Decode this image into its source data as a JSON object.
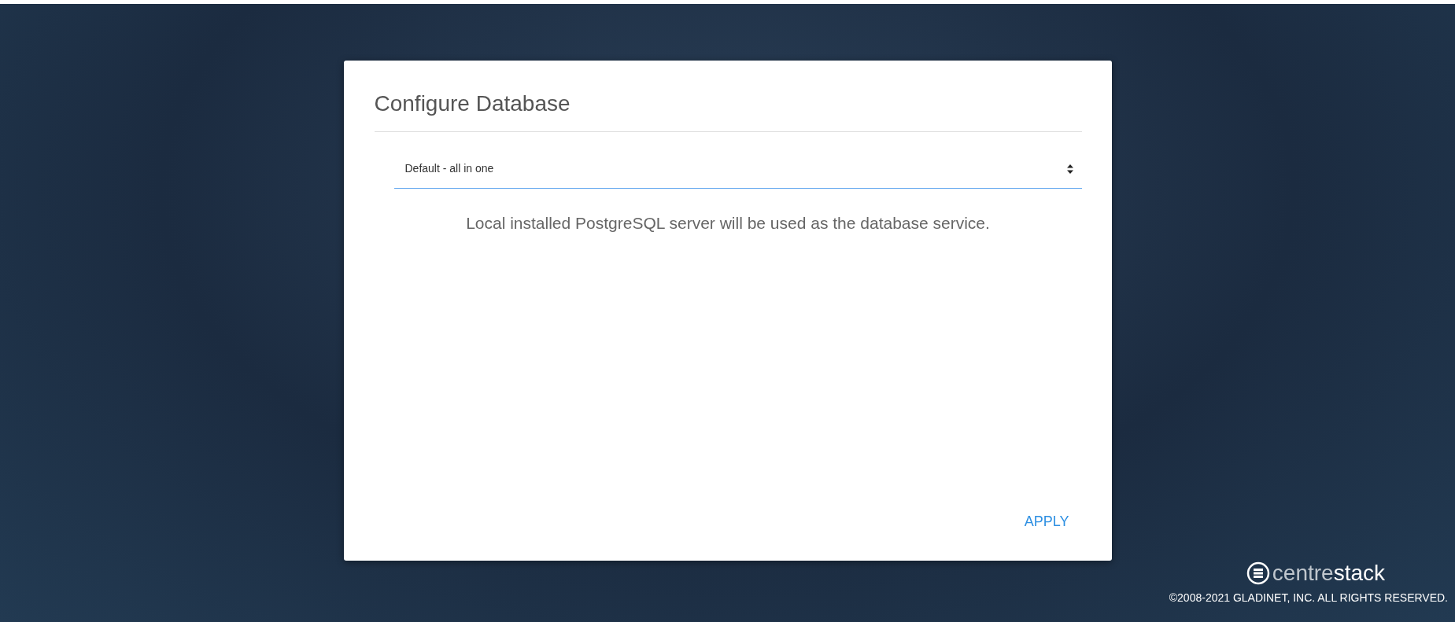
{
  "dialog": {
    "title": "Configure Database",
    "database_select": {
      "value": "Default - all in one"
    },
    "description": "Local installed PostgreSQL server will be used as the database service.",
    "buttons": [
      {
        "label": "APPLY"
      }
    ]
  },
  "footer": {
    "logo_parts": [
      "centre",
      "stack"
    ],
    "copyright": "©2008-2021 GLADINET, INC. ALL RIGHTS RESERVED."
  }
}
